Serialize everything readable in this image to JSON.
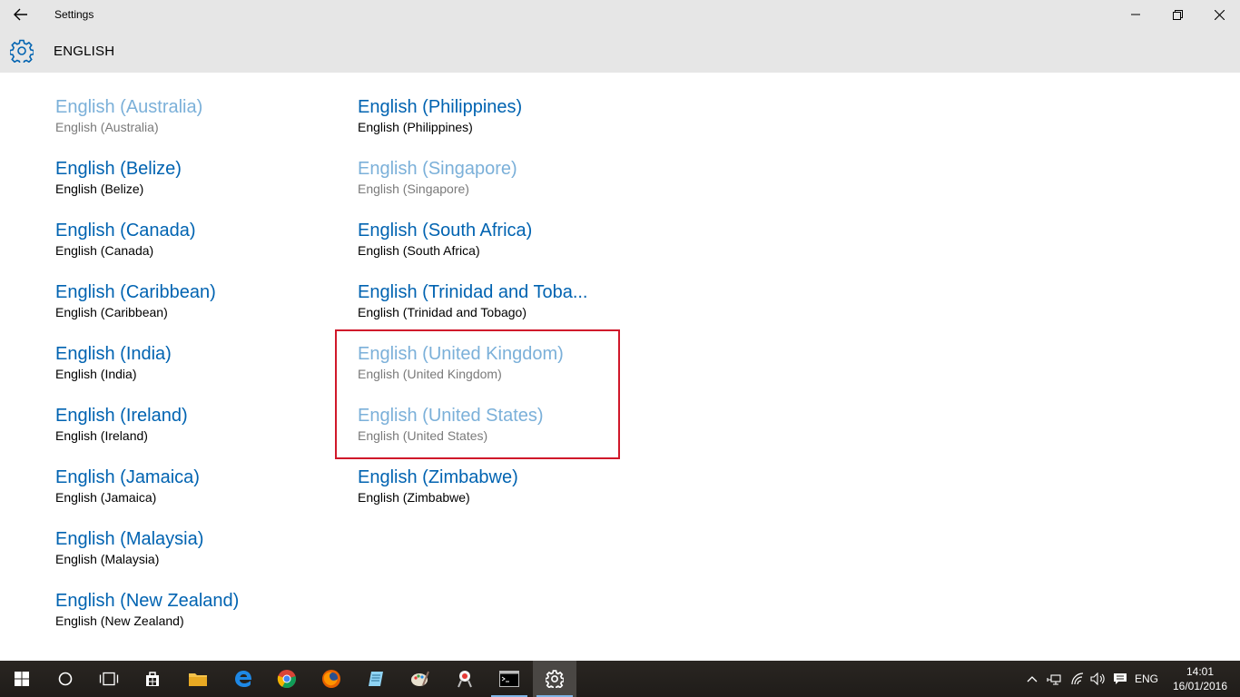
{
  "window": {
    "title": "Settings",
    "back_icon": "back-arrow-icon",
    "controls": [
      "minimize-icon",
      "restore-icon",
      "close-icon"
    ]
  },
  "header": {
    "icon": "gear-icon",
    "title": "ENGLISH"
  },
  "languages": [
    {
      "name": "English (Australia)",
      "native": "English (Australia)",
      "enabled": false
    },
    {
      "name": "English (Belize)",
      "native": "English (Belize)",
      "enabled": true
    },
    {
      "name": "English (Canada)",
      "native": "English (Canada)",
      "enabled": true
    },
    {
      "name": "English (Caribbean)",
      "native": "English (Caribbean)",
      "enabled": true
    },
    {
      "name": "English (India)",
      "native": "English (India)",
      "enabled": true
    },
    {
      "name": "English (Ireland)",
      "native": "English (Ireland)",
      "enabled": true
    },
    {
      "name": "English (Jamaica)",
      "native": "English (Jamaica)",
      "enabled": true
    },
    {
      "name": "English (Malaysia)",
      "native": "English (Malaysia)",
      "enabled": true
    },
    {
      "name": "English (New Zealand)",
      "native": "English (New Zealand)",
      "enabled": true
    },
    {
      "name": "English (Philippines)",
      "native": "English (Philippines)",
      "enabled": true
    },
    {
      "name": "English (Singapore)",
      "native": "English (Singapore)",
      "enabled": false
    },
    {
      "name": "English (South Africa)",
      "native": "English (South Africa)",
      "enabled": true
    },
    {
      "name": "English (Trinidad and Toba...",
      "native": "English (Trinidad and Tobago)",
      "enabled": true
    },
    {
      "name": "English (United Kingdom)",
      "native": "English (United Kingdom)",
      "enabled": false
    },
    {
      "name": "English (United States)",
      "native": "English (United States)",
      "enabled": false
    },
    {
      "name": "English (Zimbabwe)",
      "native": "English (Zimbabwe)",
      "enabled": true
    }
  ],
  "colors": {
    "accent": "#0063b1",
    "accent_disabled": "#7bb0d9",
    "highlight": "#d0182a",
    "chrome": "#e6e6e6"
  },
  "taskbar": {
    "apps": [
      "windows-start-icon",
      "cortana-icon",
      "task-view-icon",
      "store-icon",
      "file-explorer-icon",
      "edge-icon",
      "chrome-icon",
      "firefox-icon",
      "notepad-icon",
      "paint-icon",
      "snipping-icon",
      "command-prompt-icon",
      "settings-icon"
    ],
    "tray_icons": [
      "chevron-up-icon",
      "network-icon",
      "wifi-icon",
      "volume-icon",
      "notification-icon"
    ],
    "language": "ENG",
    "time": "14:01",
    "date": "16/01/2016"
  }
}
